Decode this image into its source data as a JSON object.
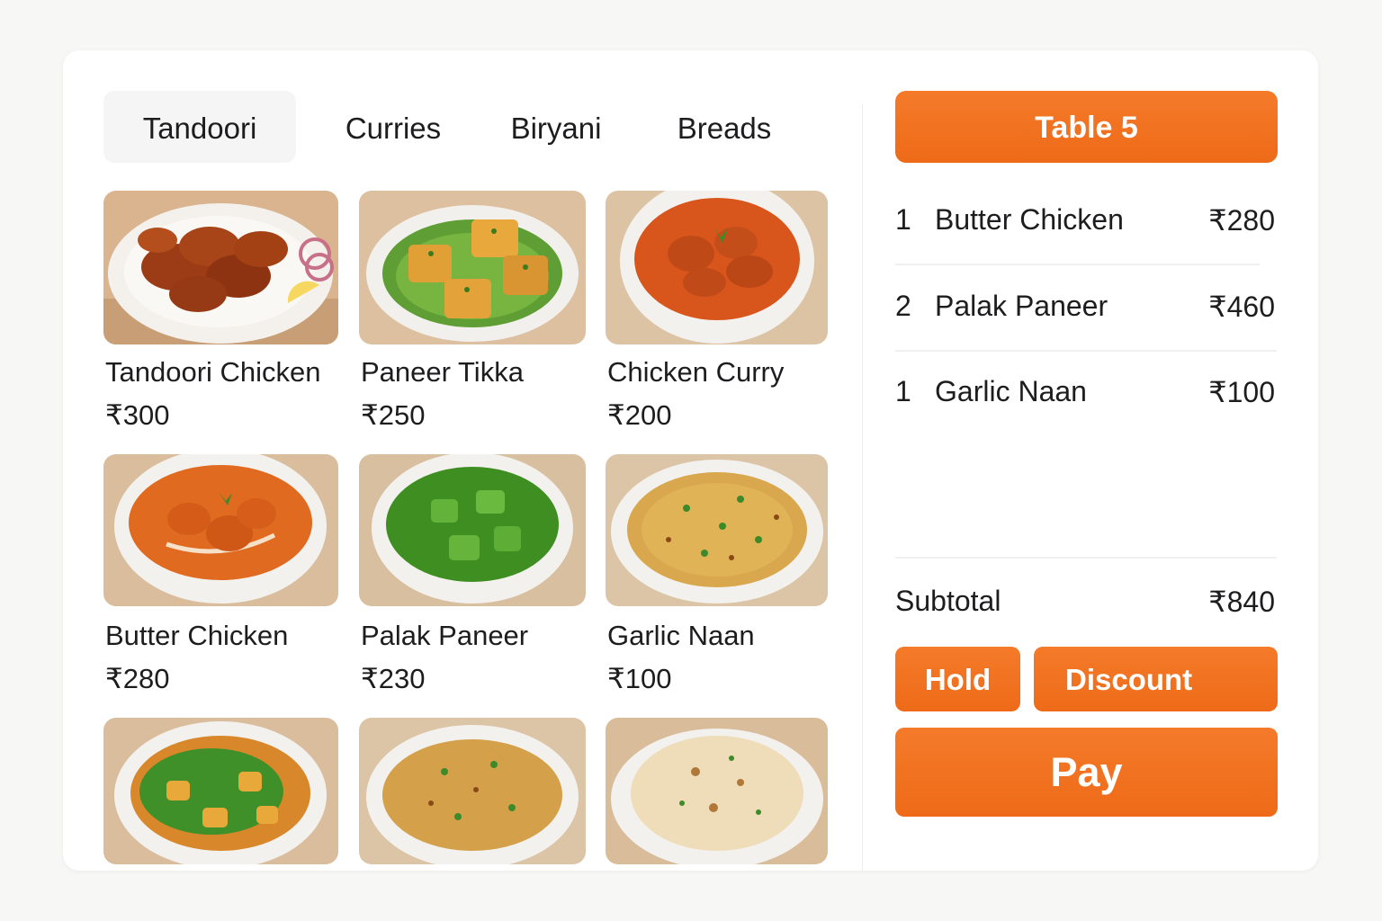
{
  "tabs": [
    {
      "label": "Tandoori",
      "active": true
    },
    {
      "label": "Curries",
      "active": false
    },
    {
      "label": "Biryani",
      "active": false
    },
    {
      "label": "Breads",
      "active": false
    }
  ],
  "menu_items": [
    {
      "name": "Tandoori Chicken",
      "price": "₹300",
      "image": "tandoori-chicken-plate"
    },
    {
      "name": "Paneer Tikka",
      "price": "₹250",
      "image": "paneer-tikka-plate"
    },
    {
      "name": "Chicken Curry",
      "price": "₹200",
      "image": "chicken-curry-bowl"
    },
    {
      "name": "Butter Chicken",
      "price": "₹280",
      "image": "butter-chicken-bowl"
    },
    {
      "name": "Palak Paneer",
      "price": "₹230",
      "image": "palak-paneer-bowl"
    },
    {
      "name": "Garlic Naan",
      "price": "₹100",
      "image": "biryani-rice-plate"
    },
    {
      "name": "",
      "price": "",
      "image": "saag-curry-bowl"
    },
    {
      "name": "",
      "price": "",
      "image": "biryani-rice-plate"
    },
    {
      "name": "",
      "price": "",
      "image": "naan-plate"
    }
  ],
  "order": {
    "table_label": "Table 5",
    "items": [
      {
        "qty": "1",
        "name": "Butter Chicken",
        "amount": "₹280"
      },
      {
        "qty": "2",
        "name": "Palak Paneer",
        "amount": "₹460"
      },
      {
        "qty": "1",
        "name": "Garlic Naan",
        "amount": "₹100"
      }
    ],
    "subtotal_label": "Subtotal",
    "subtotal_value": "₹840",
    "hold_label": "Hold",
    "discount_label": "Discount",
    "pay_label": "Pay"
  },
  "colors": {
    "accent": "#f07020",
    "panel": "#ffffff",
    "background": "#f7f7f6"
  }
}
